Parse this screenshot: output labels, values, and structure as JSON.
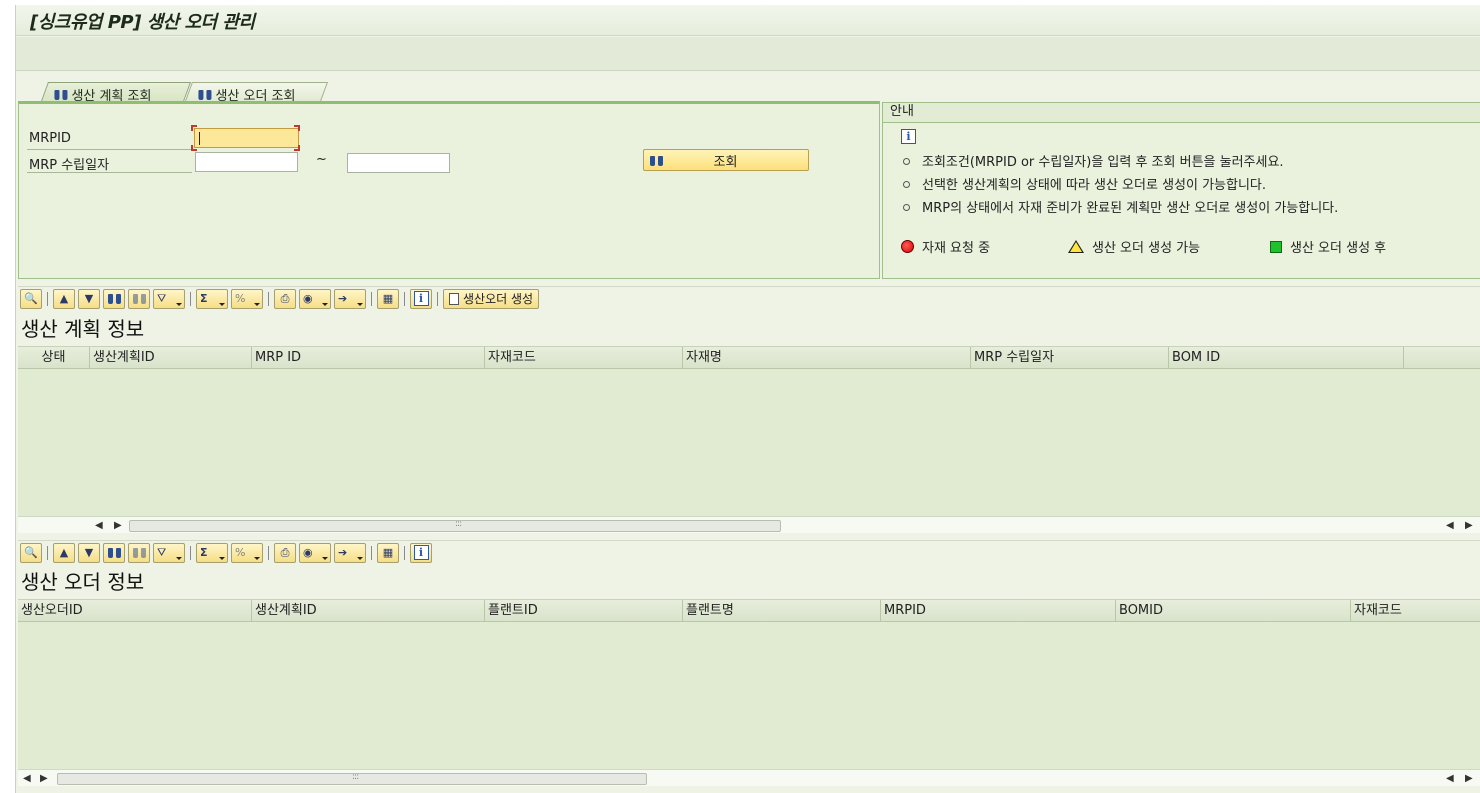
{
  "window": {
    "title": "[싱크유업 PP] 생산 오더 관리"
  },
  "tabs": [
    {
      "label": "생산 계획 조회",
      "active": true
    },
    {
      "label": "생산 오더 조회",
      "active": false
    }
  ],
  "search": {
    "mrpid_label": "MRPID",
    "mrpid_value": "",
    "date_label": "MRP 수립일자",
    "date_from": "",
    "date_to": "",
    "range_separator": "~",
    "search_button": "조회"
  },
  "guide": {
    "header": "안내",
    "lines": [
      "조회조건(MRPID or 수립일자)을 입력 후 조회 버튼을 눌러주세요.",
      "선택한 생산계획의 상태에 따라 생산 오더로 생성이 가능합니다.",
      "MRP의 상태에서 자재 준비가 완료된 계획만 생산 오더로 생성이 가능합니다."
    ],
    "legend": [
      {
        "label": "자재 요청 중",
        "color": "#e00000"
      },
      {
        "label": "생산 오더 생성 가능",
        "color": "#ffe43a"
      },
      {
        "label": "생산 오더 생성 후",
        "color": "#1fc22c"
      }
    ]
  },
  "plan_grid": {
    "title": "생산 계획 정보",
    "create_button": "생산오더 생성",
    "columns": [
      "상태",
      "생산계획ID",
      "MRP ID",
      "자재코드",
      "자재명",
      "MRP 수립일자",
      "BOM ID",
      ""
    ]
  },
  "order_grid": {
    "title": "생산 오더 정보",
    "columns": [
      "생산오더ID",
      "생산계획ID",
      "플랜트ID",
      "플랜트명",
      "MRPID",
      "BOMID",
      "자재코드"
    ]
  }
}
